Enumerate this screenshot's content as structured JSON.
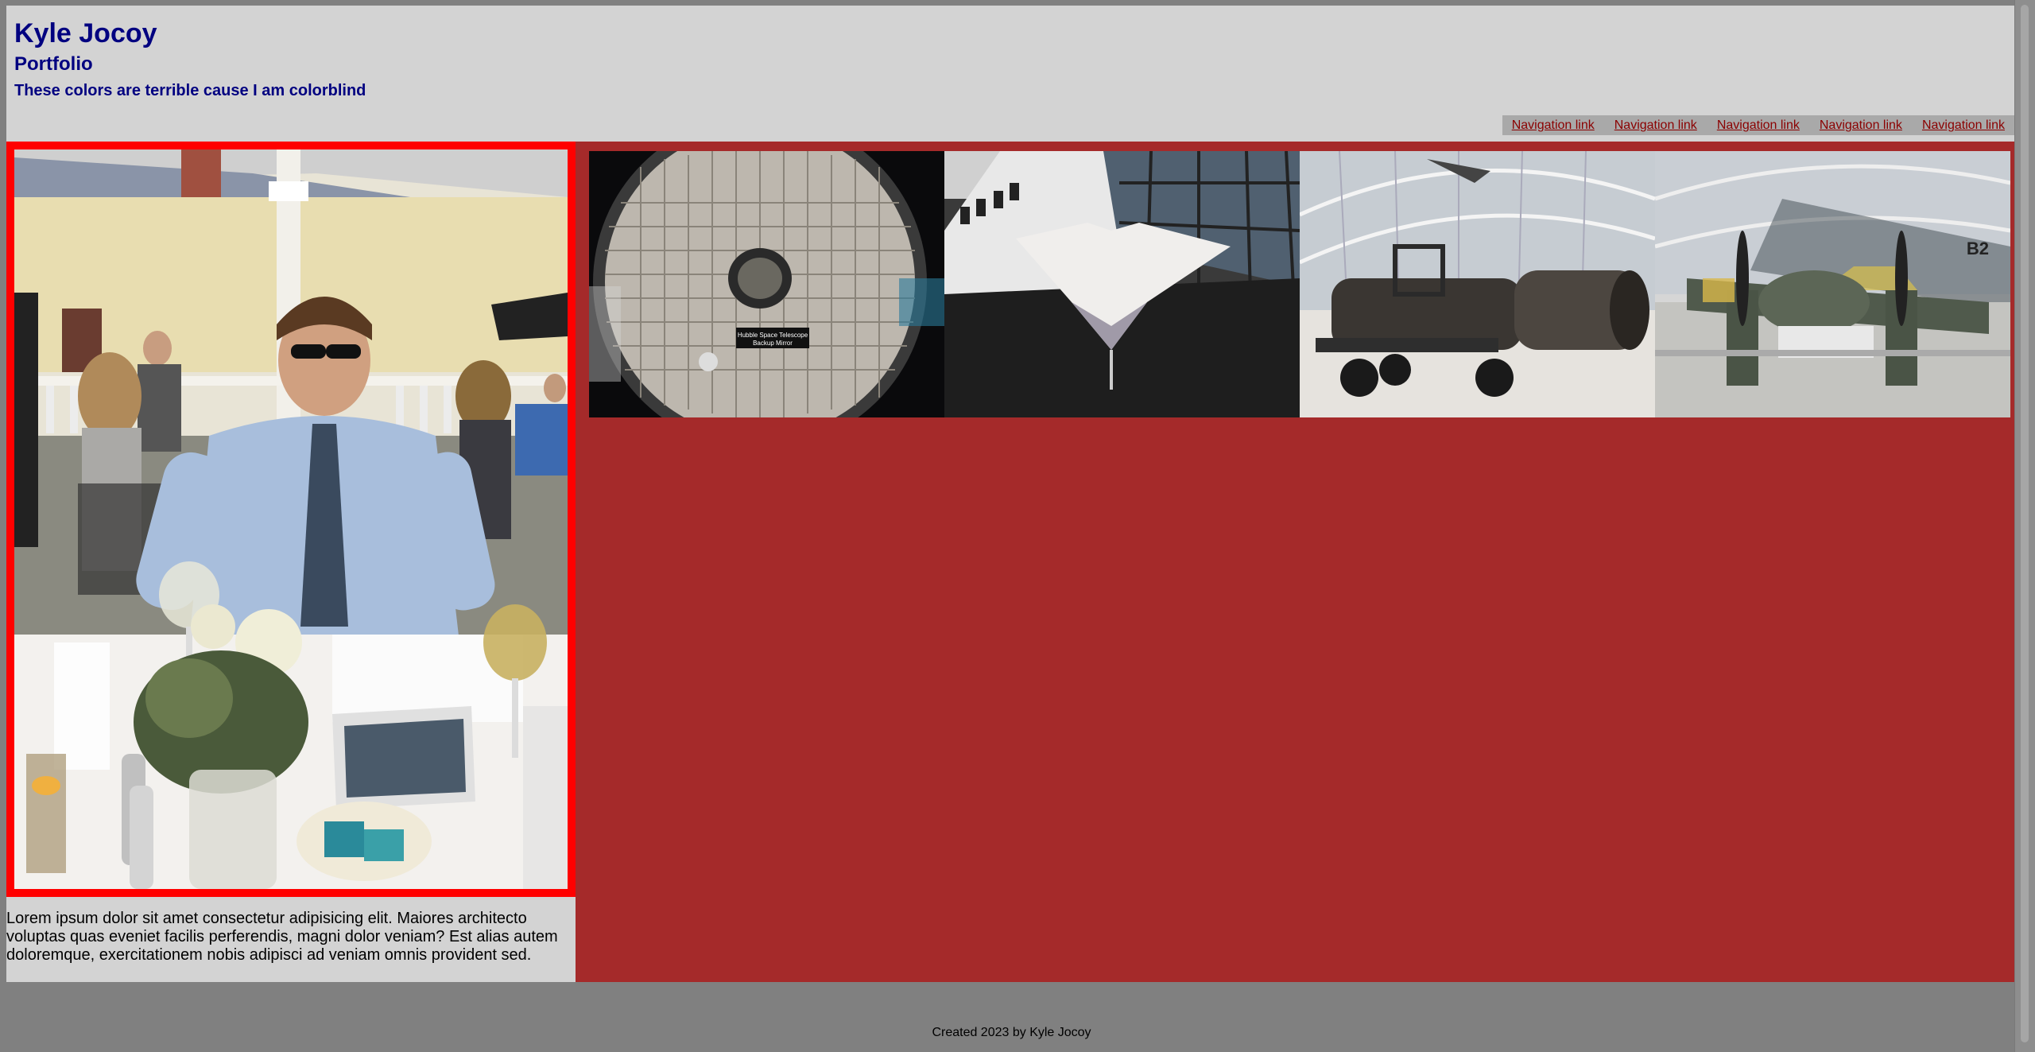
{
  "header": {
    "title": "Kyle Jocoy",
    "subtitle": "Portfolio",
    "tagline": "These colors are terrible cause I am colorblind"
  },
  "nav": {
    "links": [
      "Navigation link",
      "Navigation link",
      "Navigation link",
      "Navigation link",
      "Navigation link"
    ]
  },
  "main": {
    "paragraph": "Lorem ipsum dolor sit amet consectetur adipisicing elit. Maiores architecto voluptas quas eveniet facilis perferendis, magni dolor veniam? Est alias autem doloremque, exercitationem nobis adipisci ad veniam omnis provident sed."
  },
  "gallery": {
    "mirror_label_line1": "Hubble Space Telescope",
    "mirror_label_line2": "Backup Mirror",
    "plane_tail": "B2"
  },
  "footer": {
    "text": "Created 2023 by Kyle Jocoy"
  },
  "colors": {
    "page_bg": "#808080",
    "header_bg": "#d3d3d3",
    "heading": "#000080",
    "nav_bg": "#a9a9a9",
    "nav_link": "#8b0000",
    "gallery_bg": "#a52a2a",
    "feature_border": "#ff0000"
  }
}
